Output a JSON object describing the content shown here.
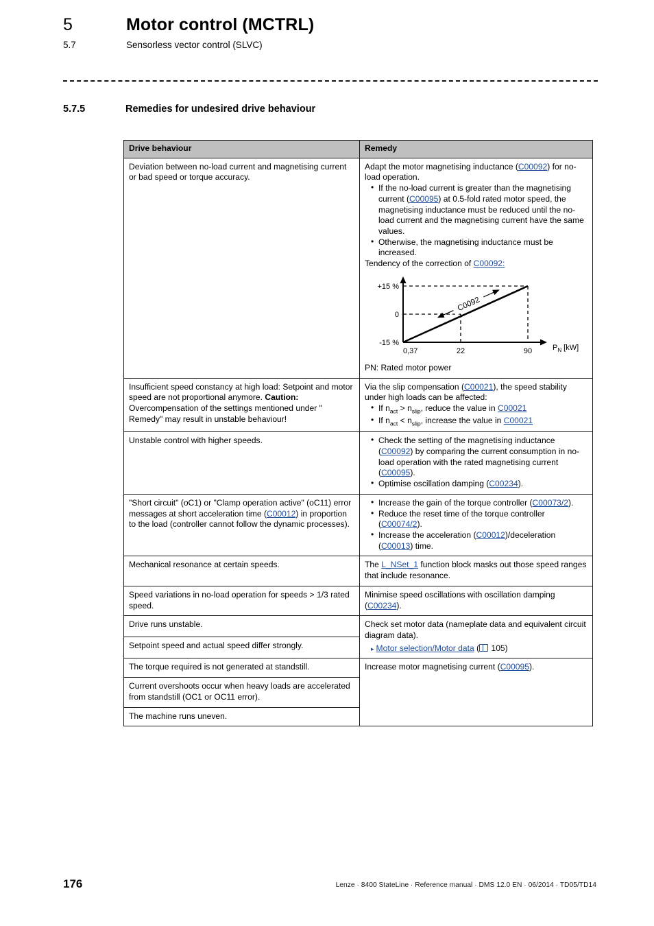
{
  "header": {
    "chapter_number": "5",
    "chapter_title": "Motor control (MCTRL)",
    "section_number": "5.7",
    "section_title": "Sensorless vector control (SLVC)"
  },
  "section": {
    "number": "5.7.5",
    "title": "Remedies for undesired drive behaviour"
  },
  "table": {
    "columns": [
      "Drive behaviour",
      "Remedy"
    ],
    "rows": [
      {
        "behaviour": "Deviation between no-load current and magnetising current or bad speed or torque accuracy.",
        "remedy_intro_a": "Adapt the motor magnetising inductance (",
        "remedy_link_1": "C00092",
        "remedy_intro_b": ") for no-load operation.",
        "bullet_1_a": "If the no-load current is greater than the magnetising current (",
        "bullet_1_link": "C00095",
        "bullet_1_b": ") at 0.5-fold rated motor speed, the magnetising inductance must be reduced until the no-load current and the magnetising current have the same values.",
        "bullet_2": "Otherwise, the magnetising inductance must be increased.",
        "tendency_text": "Tendency of the correction of ",
        "tendency_link": "C00092:",
        "chart_caption": "PN: Rated motor power"
      },
      {
        "behaviour_line1": "Insufficient speed constancy at high load: Setpoint and motor speed are not proportional anymore.",
        "caution_label": "Caution:",
        "behaviour_line2": " Overcompensation of the settings mentioned under \" Remedy\" may result in unstable behaviour!",
        "remedy_a": "Via the slip compensation (",
        "remedy_link": "C00021",
        "remedy_b": "), the speed stability under high loads can be affected:",
        "bullet_1_pre": "If n",
        "bullet_1_sub1": "act",
        "bullet_1_mid": " > n",
        "bullet_1_sub2": "slip",
        "bullet_1_post": ", reduce the value in ",
        "bullet_1_link": "C00021",
        "bullet_2_pre": "If n",
        "bullet_2_sub1": "act",
        "bullet_2_mid": " < n",
        "bullet_2_sub2": "slip",
        "bullet_2_post": ", increase the value in ",
        "bullet_2_link": "C00021"
      },
      {
        "behaviour": "Unstable control with higher speeds.",
        "bullet_1_a": "Check the setting of the magnetising inductance (",
        "bullet_1_link1": "C00092",
        "bullet_1_b": ") by comparing the current consumption in no-load operation with the rated magnetising current (",
        "bullet_1_link2": "C00095",
        "bullet_1_c": ").",
        "bullet_2_a": "Optimise oscillation damping (",
        "bullet_2_link": "C00234",
        "bullet_2_b": ")."
      },
      {
        "behaviour_a": "\"Short circuit\" (oC1) or \"Clamp operation active\" (oC11) error messages at short acceleration time (",
        "behaviour_link": "C00012",
        "behaviour_b": ") in proportion to the load (controller cannot follow the dynamic processes).",
        "bullet_1_a": "Increase the gain of the torque controller (",
        "bullet_1_link": "C00073/2",
        "bullet_1_b": ").",
        "bullet_2_a": "Reduce the reset time of the torque controller (",
        "bullet_2_link": "C00074/2",
        "bullet_2_b": ").",
        "bullet_3_a": "Increase the acceleration (",
        "bullet_3_link1": "C00012",
        "bullet_3_b": ")/deceleration (",
        "bullet_3_link2": "C00013",
        "bullet_3_c": ") time."
      },
      {
        "behaviour": "Mechanical resonance at certain speeds.",
        "remedy_a": "The ",
        "remedy_link": "L_NSet_1",
        "remedy_b": " function block masks out those speed ranges that include resonance."
      },
      {
        "behaviour": "Speed variations in no-load operation for speeds > 1/3 rated speed.",
        "remedy_a": "Minimise speed oscillations with oscillation damping (",
        "remedy_link": "C00234",
        "remedy_b": ")."
      },
      {
        "behaviour_1": "Drive runs unstable.",
        "behaviour_2": "Setpoint speed and actual speed differ strongly.",
        "remedy_text": "Check set motor data (nameplate data and equivalent circuit diagram data).",
        "xref_link": "Motor selection/Motor data",
        "xref_page": "105"
      },
      {
        "behaviour_1": "The torque required is not generated at standstill.",
        "behaviour_2": "Current overshoots occur when heavy loads are accelerated from standstill (OC1 or OC11 error).",
        "behaviour_3": "The machine runs uneven.",
        "remedy_a": "Increase motor magnetising current (",
        "remedy_link": "C00095",
        "remedy_b": ")."
      }
    ]
  },
  "chart_data": {
    "type": "line",
    "title": "",
    "xlabel": "PN [kW]",
    "ylabel": "",
    "x_ticks": [
      "0,37",
      "22",
      "90"
    ],
    "y_ticks": [
      "+15 %",
      "0",
      "-15 %"
    ],
    "x": [
      0.37,
      22,
      90
    ],
    "y": [
      -15,
      0,
      15
    ],
    "ylim": [
      -15,
      15
    ],
    "xlim": [
      0.37,
      90
    ],
    "series": [
      {
        "name": "C0092",
        "values": [
          -15,
          0,
          15
        ]
      }
    ],
    "annotation": "C0092",
    "grid": false,
    "legend": "none",
    "axis_x_label_main": "P",
    "axis_x_label_sub": "N",
    "axis_x_label_unit": " [kW]"
  },
  "footer": {
    "page_number": "176",
    "imprint": "Lenze · 8400 StateLine · Reference manual · DMS 12.0 EN · 06/2014 · TD05/TD14"
  }
}
